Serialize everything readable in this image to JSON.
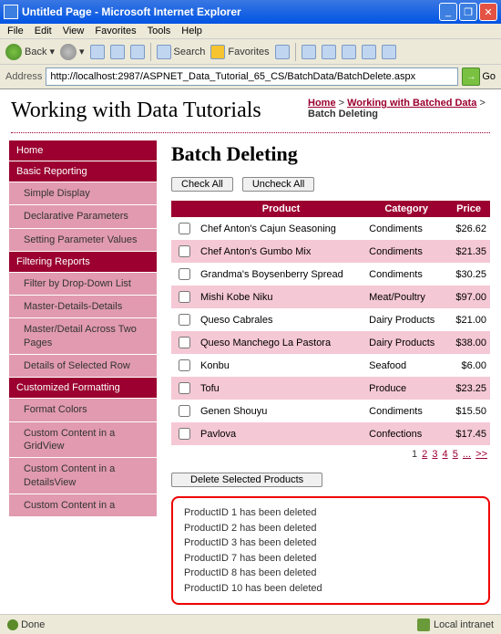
{
  "window": {
    "title": "Untitled Page - Microsoft Internet Explorer"
  },
  "menubar": [
    "File",
    "Edit",
    "View",
    "Favorites",
    "Tools",
    "Help"
  ],
  "toolbar": {
    "back": "Back",
    "search": "Search",
    "favorites": "Favorites"
  },
  "address": {
    "label": "Address",
    "url": "http://localhost:2987/ASPNET_Data_Tutorial_65_CS/BatchData/BatchDelete.aspx",
    "go": "Go"
  },
  "page_title": "Working with Data Tutorials",
  "breadcrumb": {
    "home": "Home",
    "parent": "Working with Batched Data",
    "current": "Batch Deleting"
  },
  "sidebar": [
    {
      "type": "head",
      "label": "Home"
    },
    {
      "type": "head",
      "label": "Basic Reporting"
    },
    {
      "type": "item",
      "label": "Simple Display"
    },
    {
      "type": "item",
      "label": "Declarative Parameters"
    },
    {
      "type": "item",
      "label": "Setting Parameter Values"
    },
    {
      "type": "head",
      "label": "Filtering Reports"
    },
    {
      "type": "item",
      "label": "Filter by Drop-Down List"
    },
    {
      "type": "item",
      "label": "Master-Details-Details"
    },
    {
      "type": "item",
      "label": "Master/Detail Across Two Pages"
    },
    {
      "type": "item",
      "label": "Details of Selected Row"
    },
    {
      "type": "head",
      "label": "Customized Formatting"
    },
    {
      "type": "item",
      "label": "Format Colors"
    },
    {
      "type": "item",
      "label": "Custom Content in a GridView"
    },
    {
      "type": "item",
      "label": "Custom Content in a DetailsView"
    },
    {
      "type": "item",
      "label": "Custom Content in a"
    }
  ],
  "main": {
    "heading": "Batch Deleting",
    "check_all": "Check All",
    "uncheck_all": "Uncheck All",
    "delete_selected": "Delete Selected Products",
    "columns": {
      "product": "Product",
      "category": "Category",
      "price": "Price"
    },
    "rows": [
      {
        "product": "Chef Anton's Cajun Seasoning",
        "category": "Condiments",
        "price": "$26.62"
      },
      {
        "product": "Chef Anton's Gumbo Mix",
        "category": "Condiments",
        "price": "$21.35"
      },
      {
        "product": "Grandma's Boysenberry Spread",
        "category": "Condiments",
        "price": "$30.25"
      },
      {
        "product": "Mishi Kobe Niku",
        "category": "Meat/Poultry",
        "price": "$97.00"
      },
      {
        "product": "Queso Cabrales",
        "category": "Dairy Products",
        "price": "$21.00"
      },
      {
        "product": "Queso Manchego La Pastora",
        "category": "Dairy Products",
        "price": "$38.00"
      },
      {
        "product": "Konbu",
        "category": "Seafood",
        "price": "$6.00"
      },
      {
        "product": "Tofu",
        "category": "Produce",
        "price": "$23.25"
      },
      {
        "product": "Genen Shouyu",
        "category": "Condiments",
        "price": "$15.50"
      },
      {
        "product": "Pavlova",
        "category": "Confections",
        "price": "$17.45"
      }
    ],
    "pager": {
      "current": "1",
      "pages": [
        "2",
        "3",
        "4",
        "5"
      ],
      "ellipsis": "...",
      "next": ">>"
    },
    "messages": [
      "ProductID 1 has been deleted",
      "ProductID 2 has been deleted",
      "ProductID 3 has been deleted",
      "ProductID 7 has been deleted",
      "ProductID 8 has been deleted",
      "ProductID 10 has been deleted"
    ]
  },
  "status": {
    "done": "Done",
    "zone": "Local intranet"
  }
}
